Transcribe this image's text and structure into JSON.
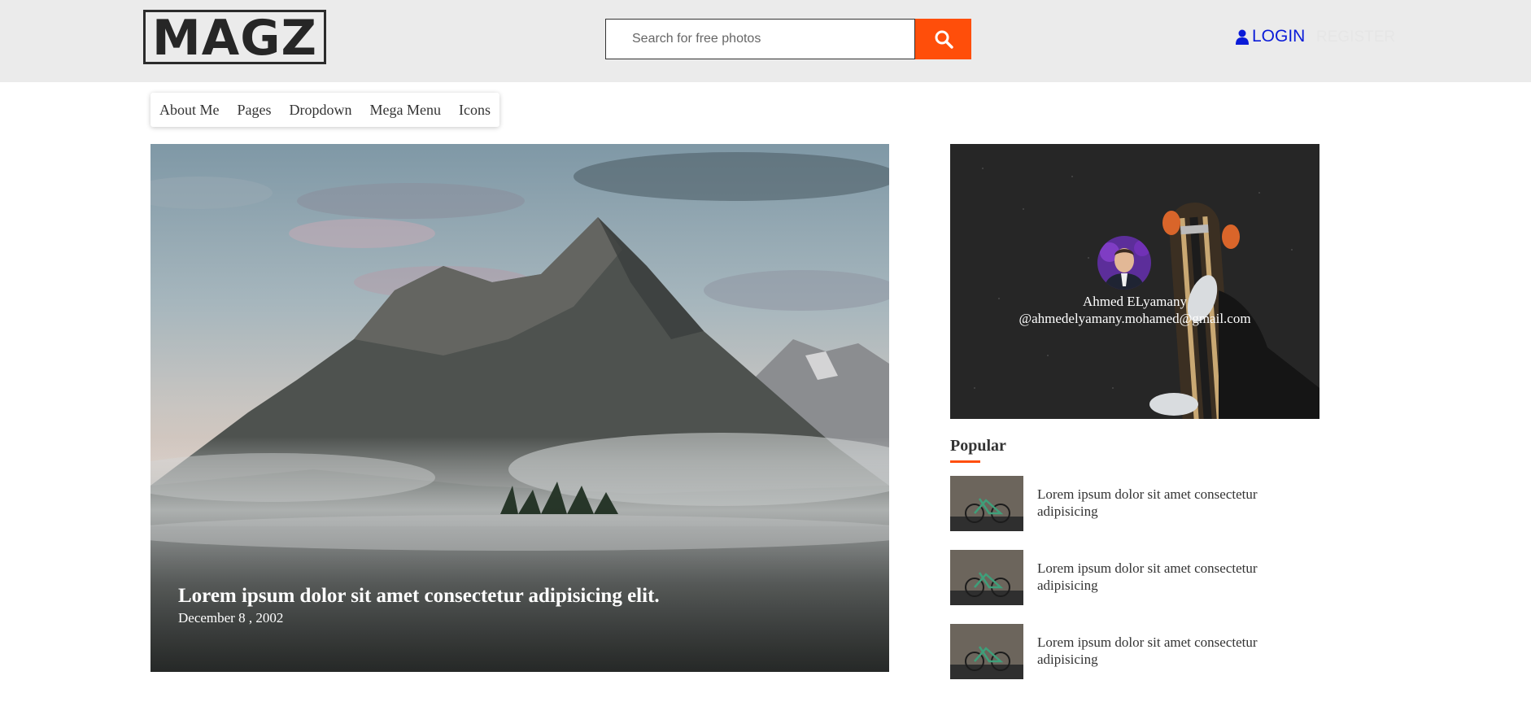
{
  "brand": {
    "logo_text": "MAGZ",
    "accent_color": "#ff4e0a",
    "link_color": "#0a1bd8"
  },
  "header": {
    "search": {
      "placeholder": "Search for free photos",
      "value": ""
    },
    "search_button_icon": "search-icon",
    "login_icon": "user-icon",
    "login_label": "LOGIN",
    "register_label": "REGISTER"
  },
  "nav": {
    "items": [
      {
        "label": "About Me"
      },
      {
        "label": "Pages"
      },
      {
        "label": "Dropdown"
      },
      {
        "label": "Mega Menu"
      },
      {
        "label": "Icons"
      }
    ]
  },
  "hero": {
    "title": "Lorem ipsum dolor sit amet consectetur adipisicing elit.",
    "date": "December 8 , 2002"
  },
  "author": {
    "name": "Ahmed ELyamany",
    "email": "@ahmedelyamany.mohamed@gmail.com"
  },
  "popular": {
    "heading": "Popular",
    "items": [
      {
        "text": "Lorem ipsum dolor sit amet consectetur adipisicing"
      },
      {
        "text": "Lorem ipsum dolor sit amet consectetur adipisicing"
      },
      {
        "text": "Lorem ipsum dolor sit amet consectetur adipisicing"
      }
    ]
  }
}
